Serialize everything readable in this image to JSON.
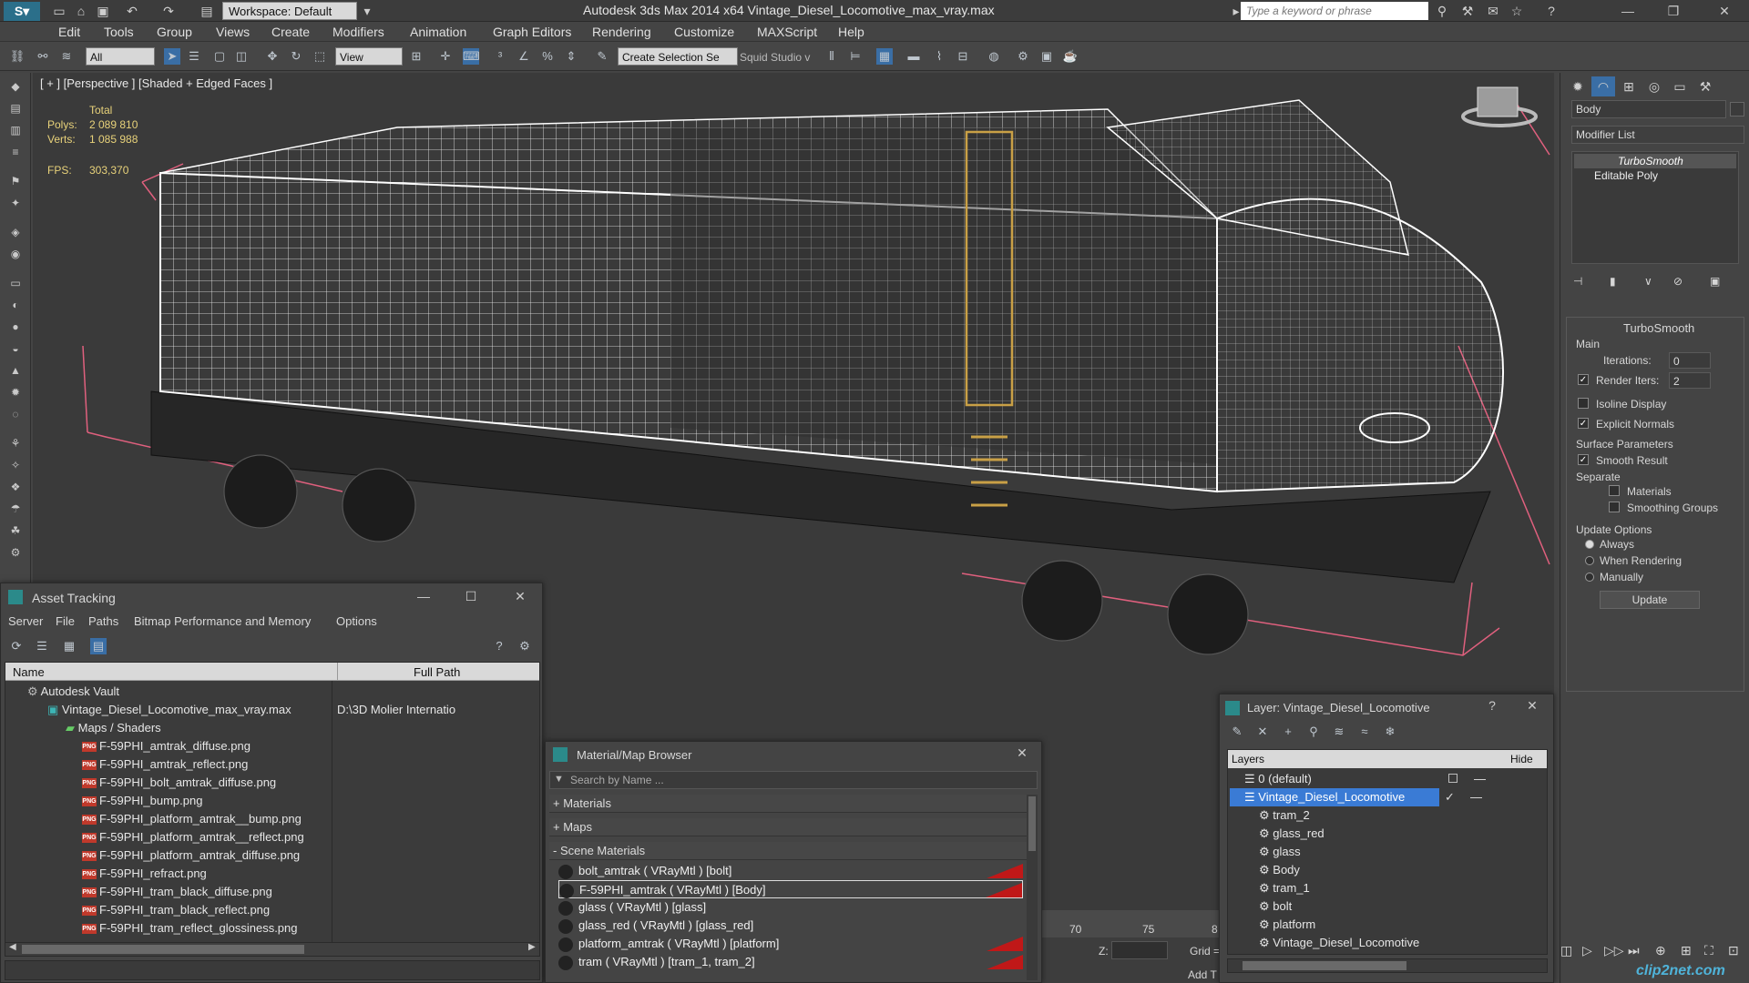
{
  "app": {
    "workspace": "Workspace: Default",
    "window_title": "Autodesk 3ds Max  2014 x64      Vintage_Diesel_Locomotive_max_vray.max",
    "search_placeholder": "Type a keyword or phrase"
  },
  "menu": [
    "Edit",
    "Tools",
    "Group",
    "Views",
    "Create",
    "Modifiers",
    "Animation",
    "Graph Editors",
    "Rendering",
    "Customize",
    "MAXScript",
    "Help"
  ],
  "toolbar": {
    "filter": "All",
    "ref_coord": "View",
    "selection_set": "Create Selection Se",
    "squid": "Squid Studio v"
  },
  "viewport": {
    "label": "[ + ] [Perspective ] [Shaded + Edged Faces ]",
    "stats": {
      "total_label": "Total",
      "polys_label": "Polys:",
      "polys": "2 089 810",
      "verts_label": "Verts:",
      "verts": "1 085 988",
      "fps_label": "FPS:",
      "fps": "303,370"
    }
  },
  "command_panel": {
    "object_name": "Body",
    "modifier_list": "Modifier List",
    "stack": [
      "TurboSmooth",
      "Editable Poly"
    ],
    "rollout_title": "TurboSmooth",
    "main_label": "Main",
    "iterations_label": "Iterations:",
    "iterations": "0",
    "render_iters_label": "Render Iters:",
    "render_iters": "2",
    "isoline": "Isoline Display",
    "explicit_normals": "Explicit Normals",
    "surface_params": "Surface Parameters",
    "smooth_result": "Smooth Result",
    "separate": "Separate",
    "materials": "Materials",
    "smoothing_groups": "Smoothing Groups",
    "update_options": "Update Options",
    "always": "Always",
    "when_rendering": "When Rendering",
    "manually": "Manually",
    "update_btn": "Update"
  },
  "asset_tracking": {
    "title": "Asset Tracking",
    "menu": [
      "Server",
      "File",
      "Paths",
      "Bitmap Performance and Memory",
      "Options"
    ],
    "col_name": "Name",
    "col_path": "Full Path",
    "vault": "Autodesk Vault",
    "max_file": "Vintage_Diesel_Locomotive_max_vray.max",
    "max_path": "D:\\3D Molier Internatio",
    "maps_folder": "Maps / Shaders",
    "files": [
      "F-59PHI_amtrak_diffuse.png",
      "F-59PHI_amtrak_reflect.png",
      "F-59PHI_bolt_amtrak_diffuse.png",
      "F-59PHI_bump.png",
      "F-59PHI_platform_amtrak__bump.png",
      "F-59PHI_platform_amtrak__reflect.png",
      "F-59PHI_platform_amtrak_diffuse.png",
      "F-59PHI_refract.png",
      "F-59PHI_tram_black_diffuse.png",
      "F-59PHI_tram_black_reflect.png",
      "F-59PHI_tram_reflect_glossiness.png"
    ]
  },
  "material_browser": {
    "title": "Material/Map Browser",
    "search_placeholder": "Search by Name ...",
    "materials_group": "+ Materials",
    "maps_group": "+ Maps",
    "scene_group": "- Scene Materials",
    "items": [
      "bolt_amtrak  ( VRayMtl ) [bolt]",
      "F-59PHI_amtrak  ( VRayMtl ) [Body]",
      "glass  ( VRayMtl ) [glass]",
      "glass_red  ( VRayMtl ) [glass_red]",
      "platform_amtrak  ( VRayMtl ) [platform]",
      "tram  ( VRayMtl ) [tram_1, tram_2]"
    ]
  },
  "layer_dialog": {
    "title": "Layer: Vintage_Diesel_Locomotive",
    "col_layers": "Layers",
    "col_hide": "Hide",
    "layers": [
      "0 (default)",
      "Vintage_Diesel_Locomotive"
    ],
    "objects": [
      "tram_2",
      "glass_red",
      "glass",
      "Body",
      "tram_1",
      "bolt",
      "platform",
      "Vintage_Diesel_Locomotive"
    ]
  },
  "timeline": {
    "ticks": [
      "70",
      "75",
      "8"
    ],
    "z_label": "Z:",
    "grid_label": "Grid =",
    "add_t": "Add T"
  },
  "watermark": "clip2net.com",
  "colors": {
    "accent": "#2b6f8a",
    "selection": "#3a7bd5",
    "wire": "#ffffff",
    "bbox": "#e0607e"
  }
}
